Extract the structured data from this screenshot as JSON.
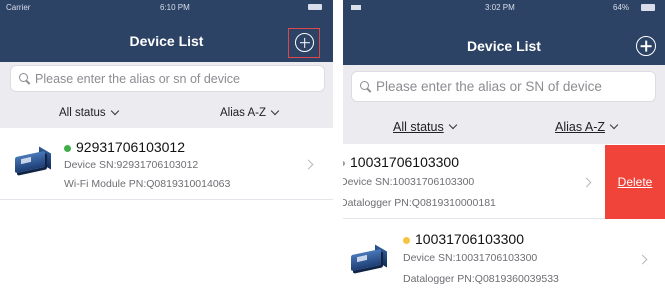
{
  "left": {
    "status": {
      "carrier": "Carrier",
      "time": "6:10 PM"
    },
    "title": "Device List",
    "search_placeholder": "Please enter the alias or sn of device",
    "filters": {
      "status": "All status",
      "sort": "Alias A-Z"
    },
    "device": {
      "title": "92931706103012",
      "dot_color": "#3fae49",
      "sn_line": "Device SN:92931706103012",
      "module_line": "Wi-Fi Module PN:Q0819310014063"
    }
  },
  "right": {
    "status": {
      "time": "3:02 PM",
      "battery": "64%"
    },
    "title": "Device List",
    "search_placeholder": "Please enter the alias or SN of device",
    "filters": {
      "status": "All status",
      "sort": "Alias A-Z"
    },
    "rows": [
      {
        "title": "10031706103300",
        "sn_line": "Device SN:10031706103300",
        "module_line": "Datalogger PN:Q0819310000181",
        "delete_label": "Delete"
      },
      {
        "title": "10031706103300",
        "dot_color": "#f5c542",
        "sn_line": "Device SN:10031706103300",
        "module_line": "Datalogger PN:Q0819360039533"
      }
    ]
  },
  "colors": {
    "navbar": "#2d4365",
    "delete": "#f0433a",
    "online": "#3fae49",
    "warning": "#f5c542"
  }
}
